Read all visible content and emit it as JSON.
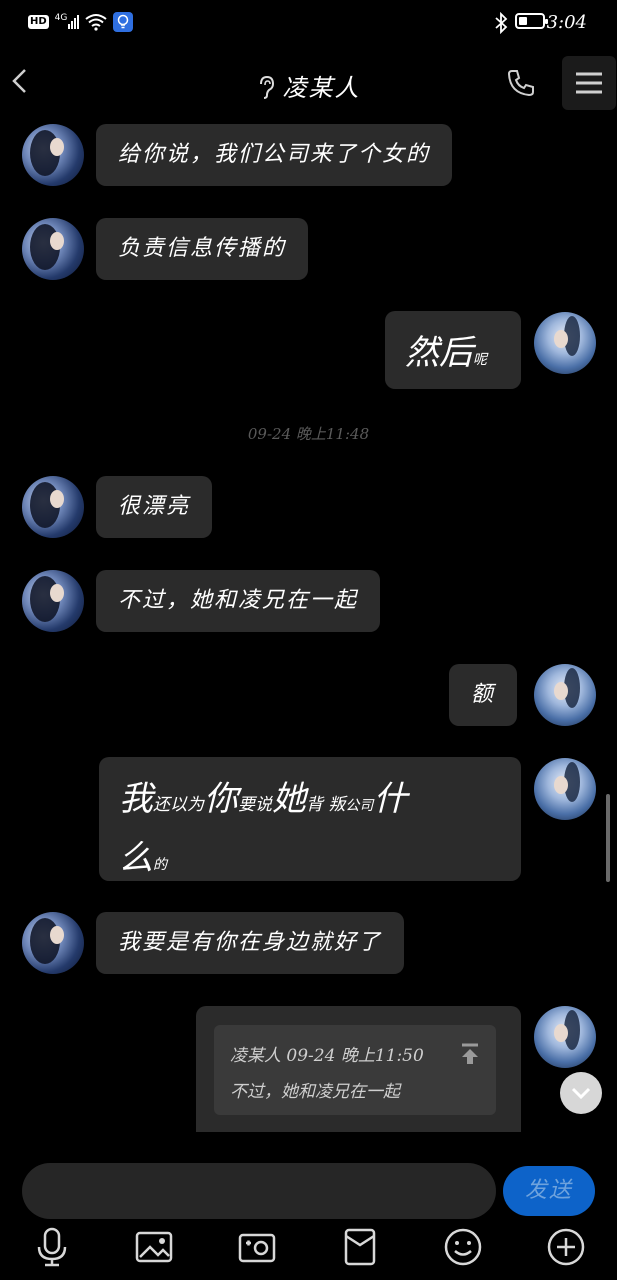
{
  "status_bar": {
    "hd": "HD",
    "network": "4G",
    "time": "3:04",
    "battery_level": 0.35
  },
  "header": {
    "contact_name": "凌某人"
  },
  "messages": {
    "m1": "给你说，我们公司来了个女的",
    "m2": "负责信息传播的",
    "m3_a": "然后",
    "m3_b": "呢",
    "timestamp": "09-24 晚上11:48",
    "m4": "很漂亮",
    "m5": "不过，她和凌兄在一起",
    "m6": "额",
    "m7": {
      "p1": "我",
      "p2": "还以为",
      "p3": "你",
      "p4": "要说",
      "p5": "她",
      "p6": "背 叛",
      "p7": "公司",
      "p8": "什",
      "p9": "么",
      "p10": "的"
    },
    "m8": "我要是有你在身边就好了"
  },
  "quote": {
    "header": "凌某人 09-24 晚上11:50",
    "body": "不过，她和凌兄在一起"
  },
  "composer": {
    "placeholder": "",
    "send_label": "发送"
  },
  "toolbar": {
    "icons": [
      "microphone-icon",
      "image-icon",
      "camera-icon",
      "red-packet-icon",
      "emoji-icon",
      "plus-icon"
    ]
  }
}
